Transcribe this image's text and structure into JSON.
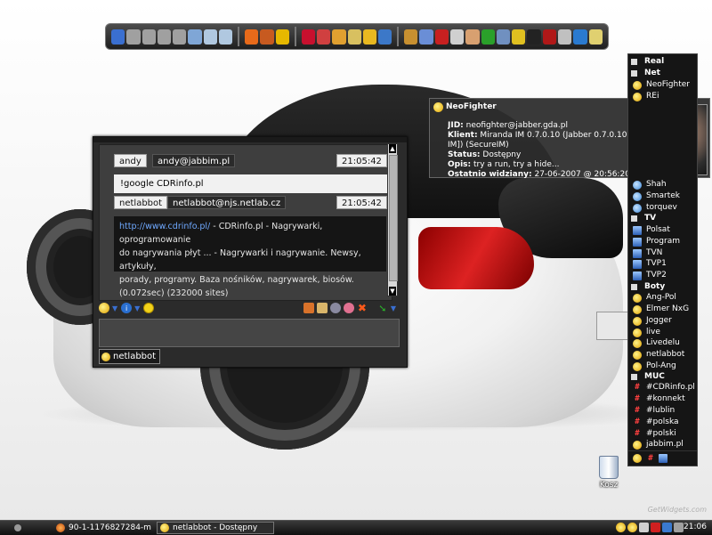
{
  "dock": {
    "icons": [
      {
        "name": "monitor-icon",
        "color": "#3a6fd0"
      },
      {
        "name": "drive-icon",
        "color": "#a0a0a0"
      },
      {
        "name": "drive-icon",
        "color": "#a0a0a0"
      },
      {
        "name": "drive-icon",
        "color": "#a0a0a0"
      },
      {
        "name": "drive-icon",
        "color": "#a0a0a0"
      },
      {
        "name": "usb-icon",
        "color": "#7fa6d6"
      },
      {
        "name": "network-drive-icon",
        "color": "#b0c8e0"
      },
      {
        "name": "network-drive-icon",
        "color": "#b0c8e0"
      },
      {
        "name": "firefox-icon",
        "color": "#e86a1a"
      },
      {
        "name": "firefox-icon",
        "color": "#c75a20"
      },
      {
        "name": "winamp-icon",
        "color": "#e6b800"
      },
      {
        "name": "acrobat-icon",
        "color": "#c8102e"
      },
      {
        "name": "nero-icon",
        "color": "#d04040"
      },
      {
        "name": "cake-icon",
        "color": "#e0a030"
      },
      {
        "name": "disc-icon",
        "color": "#d8c060"
      },
      {
        "name": "sunflower-icon",
        "color": "#e8b820"
      },
      {
        "name": "globe-icon",
        "color": "#3c78c8"
      },
      {
        "name": "cake-icon",
        "color": "#c89030"
      },
      {
        "name": "floppy-icon",
        "color": "#6a8ed6"
      },
      {
        "name": "pencil-icon",
        "color": "#c82020"
      },
      {
        "name": "headphones-icon",
        "color": "#d0d0d0"
      },
      {
        "name": "hand-icon",
        "color": "#d8a070"
      },
      {
        "name": "utorrent-icon",
        "color": "#2aa02a"
      },
      {
        "name": "network-icon",
        "color": "#7090c0"
      },
      {
        "name": "key-icon",
        "color": "#e0c020"
      },
      {
        "name": "terminal-icon",
        "color": "#222222"
      },
      {
        "name": "aimp-icon",
        "color": "#b01818"
      },
      {
        "name": "window-icon",
        "color": "#c0c0c0"
      },
      {
        "name": "info-icon",
        "color": "#2a7ad0"
      },
      {
        "name": "notepad-icon",
        "color": "#e0d070"
      }
    ]
  },
  "chat": {
    "msg1": {
      "nick": "andy",
      "jid": "andy@jabbim.pl",
      "time": "21:05:42",
      "text": "!google CDRinfo.pl"
    },
    "msg2": {
      "nick": "netlabbot",
      "jid": "netlabbot@njs.netlab.cz",
      "time": "21:05:42",
      "link": "http://www.cdrinfo.pl/",
      "line1_rest": " - CDRinfo.pl - Nagrywarki, oprogramowanie",
      "line2": "do nagrywania płyt ... - Nagrywarki i nagrywanie. Newsy, artykuły,",
      "line3": "porady, programy. Baza nośników,   nagrywarek, biosów.",
      "line4": "(0.072sec) (232000 sites)"
    },
    "contact_tab": "netlabbot",
    "scroll_up": "▲",
    "scroll_down": "▼",
    "caret": "▼"
  },
  "tooltip": {
    "title": "NeoFighter",
    "lines": [
      {
        "label": "JID:",
        "value": " neofighter@jabber.gda.pl"
      },
      {
        "label": "Klient:",
        "value": " Miranda IM 0.7.0.10 (Jabber 0.7.0.10 [Miranda"
      },
      {
        "label": "",
        "value": "IM]) (SecureIM)"
      },
      {
        "label": "Status:",
        "value": " Dostępny"
      },
      {
        "label": "Opis:",
        "value": " try a run, try a hide..."
      },
      {
        "label": "Ostatnio widziany:",
        "value": " 27-06-2007 @ 20:56:20"
      }
    ]
  },
  "contacts": [
    {
      "type": "group",
      "label": "Real"
    },
    {
      "type": "group",
      "label": "Net"
    },
    {
      "type": "contact",
      "icon": "bulb",
      "label": "NeoFighter"
    },
    {
      "type": "contact",
      "icon": "bulb",
      "label": "REi"
    },
    {
      "type": "contact",
      "icon": "jab",
      "label": "Shah"
    },
    {
      "type": "contact",
      "icon": "jab",
      "label": "Smartek"
    },
    {
      "type": "contact",
      "icon": "jab",
      "label": "torquev"
    },
    {
      "type": "group",
      "label": "TV"
    },
    {
      "type": "contact",
      "icon": "tv",
      "label": "Polsat"
    },
    {
      "type": "contact",
      "icon": "tv",
      "label": "Program"
    },
    {
      "type": "contact",
      "icon": "tv",
      "label": "TVN"
    },
    {
      "type": "contact",
      "icon": "tv",
      "label": "TVP1"
    },
    {
      "type": "contact",
      "icon": "tv",
      "label": "TVP2"
    },
    {
      "type": "group",
      "label": "Boty"
    },
    {
      "type": "contact",
      "icon": "bulb",
      "label": "Ang-Pol"
    },
    {
      "type": "contact",
      "icon": "bulb",
      "label": "Elmer NxG"
    },
    {
      "type": "contact",
      "icon": "bulb",
      "label": "Jogger"
    },
    {
      "type": "contact",
      "icon": "bulb",
      "label": "live"
    },
    {
      "type": "contact",
      "icon": "bulb",
      "label": "Livedelu"
    },
    {
      "type": "contact",
      "icon": "bulb",
      "label": "netlabbot"
    },
    {
      "type": "contact",
      "icon": "bulb",
      "label": "Pol-Ang"
    },
    {
      "type": "group",
      "label": "MUC"
    },
    {
      "type": "contact",
      "icon": "hash",
      "label": "#CDRinfo.pl"
    },
    {
      "type": "contact",
      "icon": "hash",
      "label": "#konnekt"
    },
    {
      "type": "contact",
      "icon": "hash",
      "label": "#lublin"
    },
    {
      "type": "contact",
      "icon": "hash",
      "label": "#polska"
    },
    {
      "type": "contact",
      "icon": "hash",
      "label": "#polski"
    },
    {
      "type": "contact",
      "icon": "bulb",
      "label": "jabbim.pl"
    }
  ],
  "contact_list_bottom": {
    "hash": "#"
  },
  "desktop": {
    "trash_label": "Kosz",
    "watermark": "GetWidgets.com"
  },
  "taskbar": {
    "items": [
      {
        "label": "90-1-1176827284-m1....",
        "active": false
      },
      {
        "label": "netlabbot - Dostępny",
        "active": true
      }
    ],
    "clock": "21:06"
  }
}
